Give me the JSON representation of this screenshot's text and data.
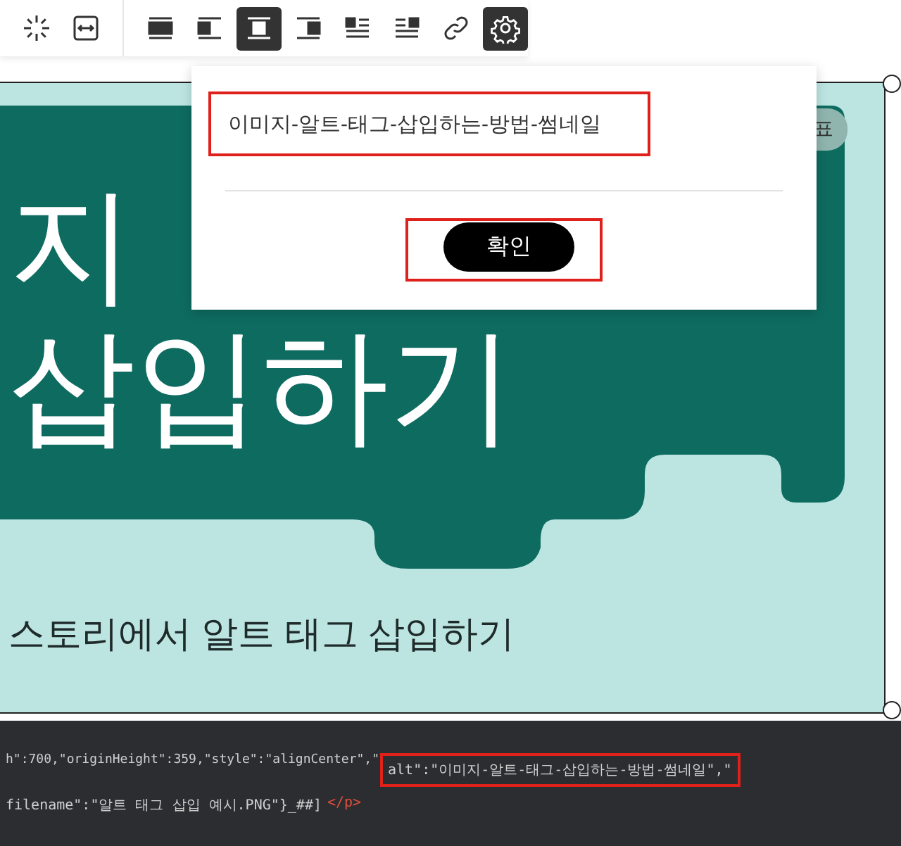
{
  "toolbar": {
    "groups": [
      {
        "buttons": [
          {
            "kind": "sparkle",
            "selected": false
          },
          {
            "kind": "resize",
            "selected": false
          }
        ]
      },
      {
        "buttons": [
          {
            "kind": "full",
            "selected": false
          },
          {
            "kind": "left",
            "selected": false
          },
          {
            "kind": "center",
            "selected": true
          },
          {
            "kind": "right",
            "selected": false
          },
          {
            "kind": "wrap-left",
            "selected": false
          },
          {
            "kind": "wrap-right",
            "selected": false
          },
          {
            "kind": "link",
            "selected": false
          },
          {
            "kind": "settings",
            "selected": true
          }
        ]
      }
    ]
  },
  "thumbnail": {
    "title_lines": [
      "지",
      "삽입하기"
    ],
    "badge": "표",
    "subtitle": "스토리에서 알트 태그 삽입하기"
  },
  "alt_popup": {
    "value": "이미지-알트-태그-삽입하는-방법-썸네일",
    "confirm": "확인"
  },
  "code": {
    "before": "h\":700,\"originHeight\":359,\"style\":\"alignCenter\",\"",
    "highlighted": "alt\":\"이미지-알트-태그-삽입하는-방법-썸네일\",\"",
    "after": "filename\":\"알트 태그 삽입 예시.PNG\"}_##]",
    "tag": "</p>"
  }
}
